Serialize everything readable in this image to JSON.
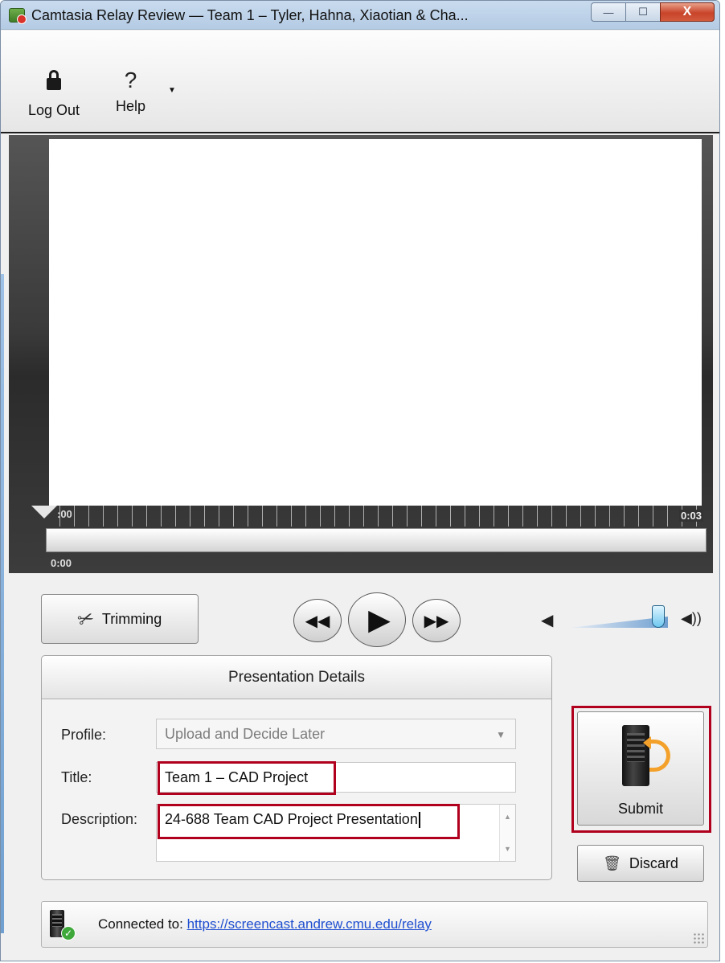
{
  "window": {
    "title": "Camtasia Relay Review — Team 1 – Tyler, Hahna, Xiaotian & Cha...",
    "minimize_glyph": "—",
    "maximize_glyph": "☐",
    "close_glyph": "X"
  },
  "toolbar": {
    "logout_label": "Log Out",
    "help_label": "Help",
    "help_glyph": "?",
    "dropdown_glyph": "▼"
  },
  "timeline": {
    "start_marker": ":00",
    "end_time": "0:03",
    "current_time": "0:00"
  },
  "controls": {
    "trimming_label": "Trimming",
    "rewind_glyph": "◀◀",
    "play_glyph": "▶",
    "forward_glyph": "▶▶",
    "volume_low_glyph": "◀",
    "volume_high_glyph": "◀))",
    "volume_level": 0.9
  },
  "details": {
    "header": "Presentation Details",
    "profile_label": "Profile:",
    "profile_value": "Upload and Decide Later",
    "title_label": "Title:",
    "title_value": "Team 1 – CAD Project",
    "description_label": "Description:",
    "description_value": "24-688 Team CAD Project Presentation"
  },
  "actions": {
    "submit_label": "Submit",
    "discard_label": "Discard"
  },
  "status": {
    "prefix": "Connected to:",
    "url": "https://screencast.andrew.cmu.edu/relay"
  },
  "colors": {
    "highlight": "#b0001e",
    "link": "#1f4fd0",
    "accent_arrow": "#f3a12a"
  }
}
